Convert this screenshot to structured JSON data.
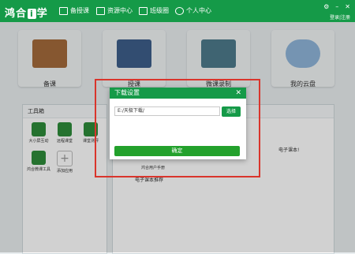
{
  "header": {
    "logo_text": "鸿合",
    "logo_mark": "i",
    "logo_suffix": "学",
    "tabs": [
      {
        "label": "备授课"
      },
      {
        "label": "资源中心"
      },
      {
        "label": "班级圈"
      },
      {
        "label": "个人中心"
      }
    ],
    "links": "登录|注册"
  },
  "tiles": [
    {
      "label": "备课"
    },
    {
      "label": "授课"
    },
    {
      "label": "微课录制"
    },
    {
      "label": "我的云盘"
    }
  ],
  "toolbox": {
    "title": "工具箱",
    "tools": [
      {
        "label": "大小屏互动"
      },
      {
        "label": "远程课堂"
      },
      {
        "label": "课堂测评"
      },
      {
        "label": "鸿合微课工具"
      },
      {
        "label": "添加应用"
      }
    ]
  },
  "right_panel": {
    "text1": "电子课本!",
    "text2": "鸿合用户手册",
    "text3": "电子课本推荐"
  },
  "dialog": {
    "title": "下载设置",
    "close_symbol": "✕",
    "path_value": "E:/天极下载/",
    "select_label": "选择",
    "ok_label": "确定"
  },
  "colors": {
    "brand": "#159a48",
    "highlight": "#d9352c"
  }
}
